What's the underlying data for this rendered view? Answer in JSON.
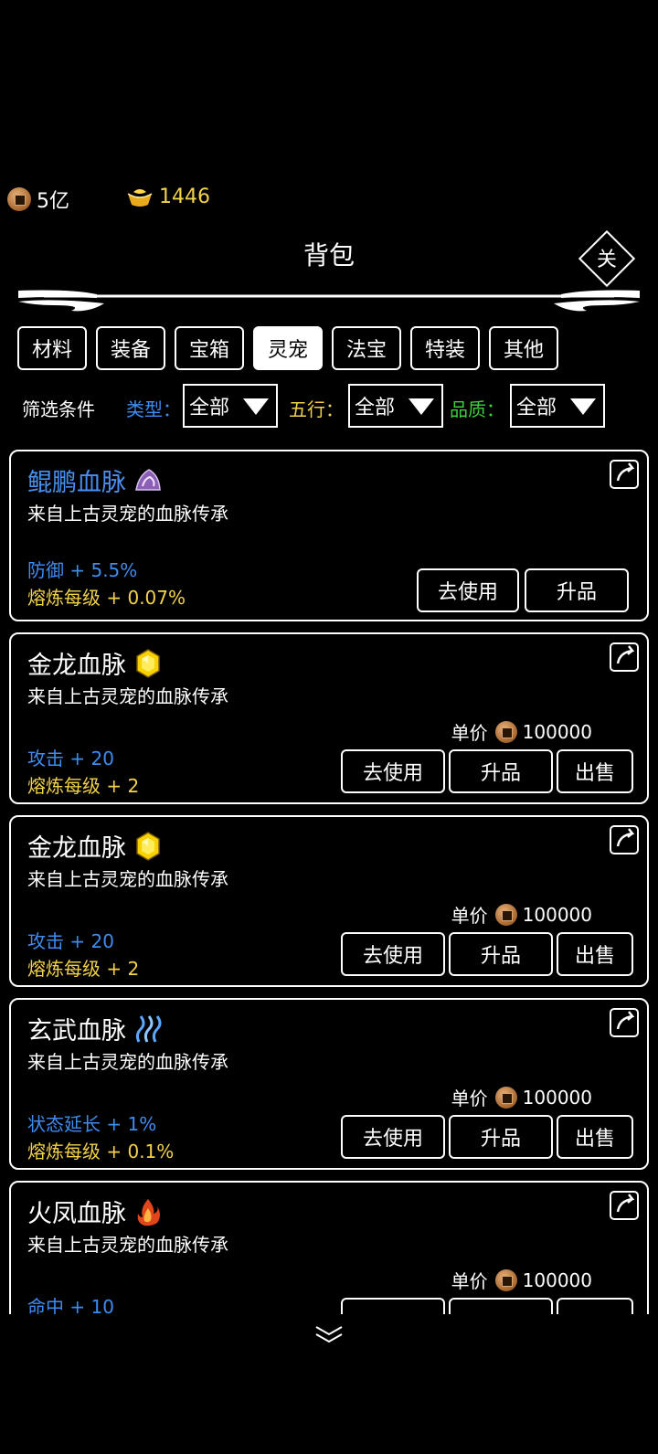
{
  "currency": {
    "coins": "5亿",
    "gold": "1446"
  },
  "header": {
    "title": "背包",
    "close_label": "关"
  },
  "tabs": [
    {
      "label": "材料",
      "active": false
    },
    {
      "label": "装备",
      "active": false
    },
    {
      "label": "宝箱",
      "active": false
    },
    {
      "label": "灵宠",
      "active": true
    },
    {
      "label": "法宝",
      "active": false
    },
    {
      "label": "特装",
      "active": false
    },
    {
      "label": "其他",
      "active": false
    }
  ],
  "filters": {
    "title": "筛选条件",
    "type_label": "类型：",
    "type_value": "全部",
    "element_label": "五行：",
    "element_value": "全部",
    "quality_label": "品质：",
    "quality_value": "全部"
  },
  "colors": {
    "type_label": "#3f8cf0",
    "element_label": "#f3d24a",
    "quality_label": "#3ed13e",
    "stat_primary": "#3f8cf0",
    "stat_secondary": "#f3d24a"
  },
  "items": [
    {
      "name": "鲲鹏血脉",
      "name_color": "#4a8ff0",
      "gem": "purple-swirl-gem-icon",
      "desc": "来自上古灵宠的血脉传承",
      "stat1": "防御 + 5.5%",
      "stat2": "熔炼每级 + 0.07%",
      "price_label": "",
      "price": "",
      "buttons": [
        "去使用",
        "升品"
      ]
    },
    {
      "name": "金龙血脉",
      "name_color": "#ffffff",
      "gem": "yellow-crystal-gem-icon",
      "desc": "来自上古灵宠的血脉传承",
      "stat1": "攻击 + 20",
      "stat2": "熔炼每级 + 2",
      "price_label": "单价",
      "price": "100000",
      "buttons": [
        "去使用",
        "升品",
        "出售"
      ]
    },
    {
      "name": "金龙血脉",
      "name_color": "#ffffff",
      "gem": "yellow-crystal-gem-icon",
      "desc": "来自上古灵宠的血脉传承",
      "stat1": "攻击 + 20",
      "stat2": "熔炼每级 + 2",
      "price_label": "单价",
      "price": "100000",
      "buttons": [
        "去使用",
        "升品",
        "出售"
      ]
    },
    {
      "name": "玄武血脉",
      "name_color": "#ffffff",
      "gem": "blue-water-gem-icon",
      "desc": "来自上古灵宠的血脉传承",
      "stat1": "状态延长 + 1%",
      "stat2": "熔炼每级 + 0.1%",
      "price_label": "单价",
      "price": "100000",
      "buttons": [
        "去使用",
        "升品",
        "出售"
      ]
    },
    {
      "name": "火凤血脉",
      "name_color": "#ffffff",
      "gem": "red-flame-gem-icon",
      "desc": "来自上古灵宠的血脉传承",
      "stat1": "命中 + 10",
      "stat2": "",
      "price_label": "单价",
      "price": "100000",
      "buttons": [
        "",
        "",
        ""
      ]
    }
  ]
}
